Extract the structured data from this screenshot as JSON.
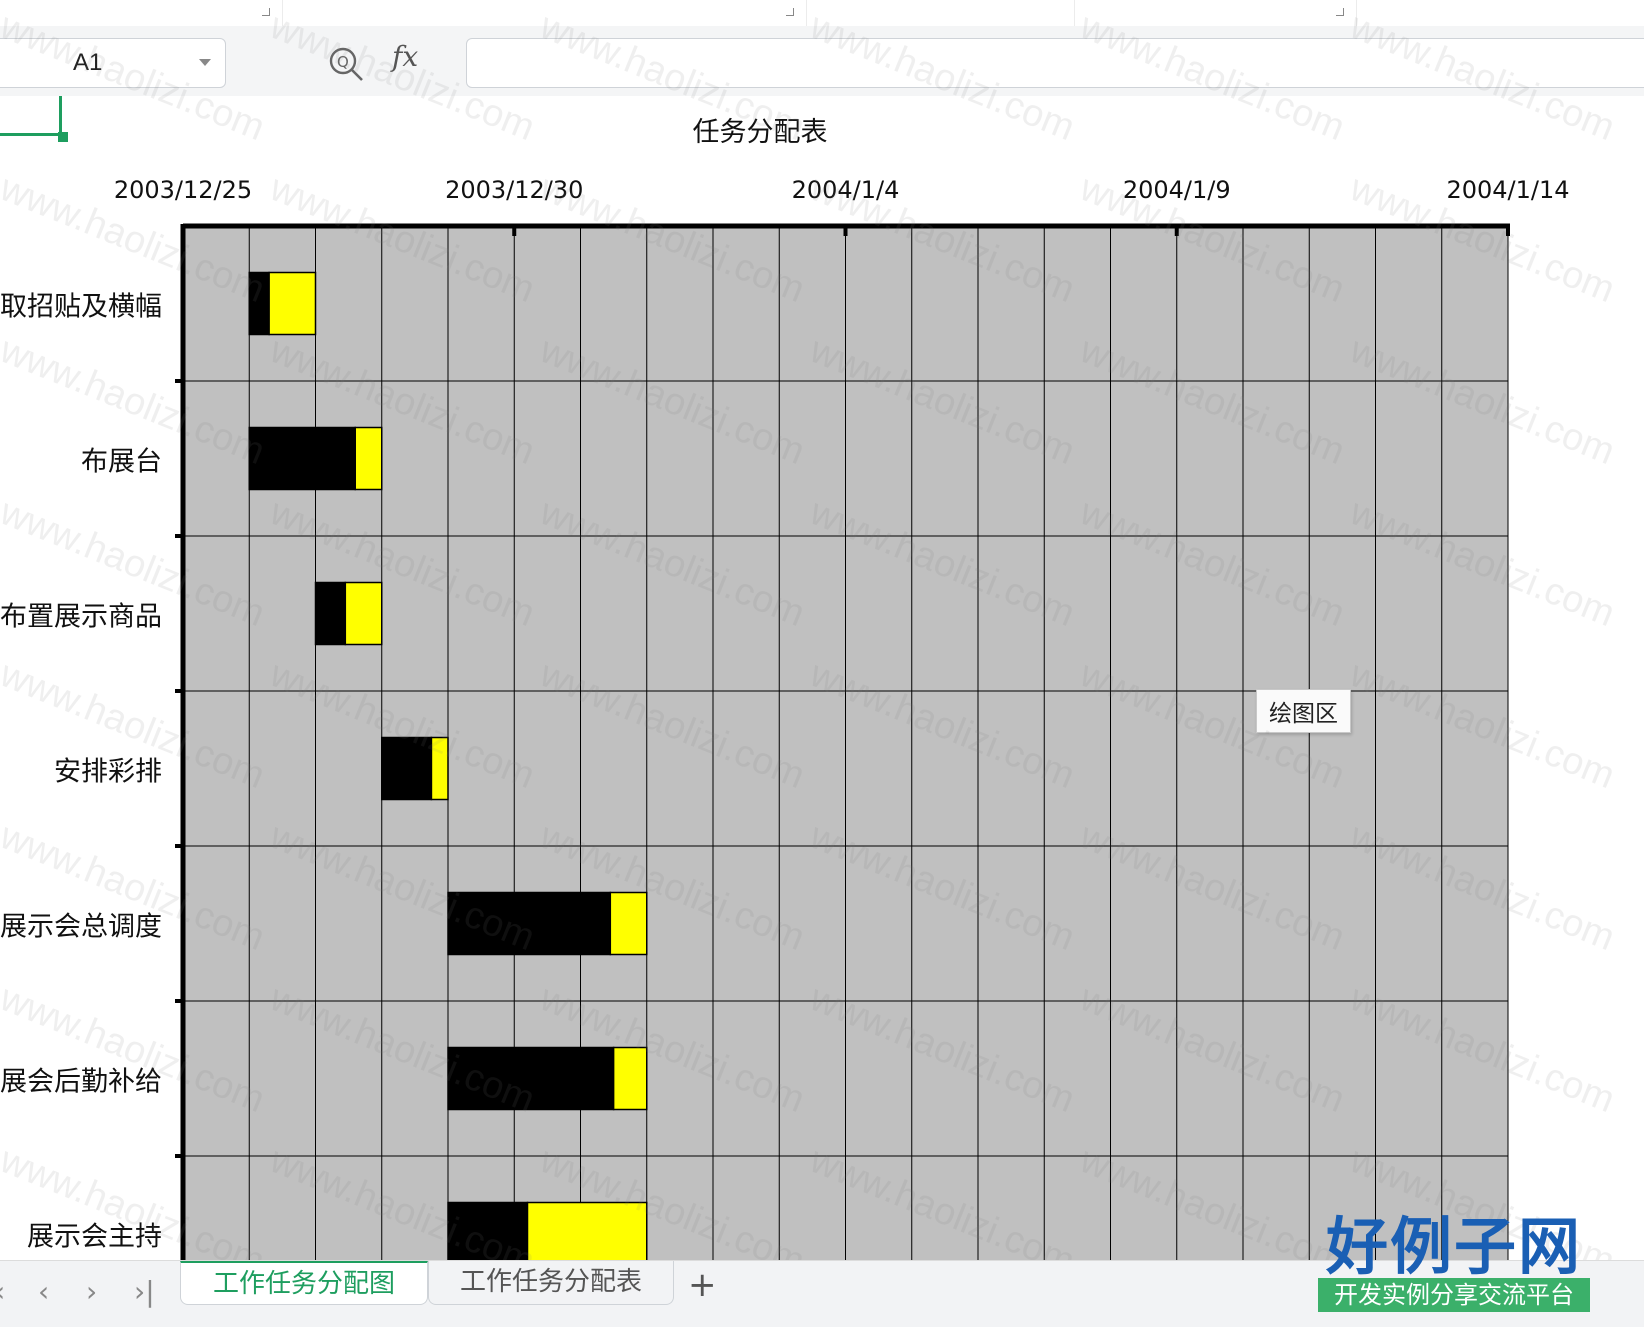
{
  "formula_bar": {
    "name_box": "A1",
    "fx_label": "fx",
    "formula_value": ""
  },
  "chart_data": {
    "type": "bar",
    "orientation": "horizontal-gantt",
    "title": "任务分配表",
    "xlabel": "",
    "ylabel": "",
    "x_axis_position": "top",
    "x_ticks": [
      "2003/12/25",
      "2003/12/30",
      "2004/1/4",
      "2004/1/9",
      "2004/1/14"
    ],
    "xlim": [
      "2003/12/25",
      "2004/1/14"
    ],
    "grid": true,
    "legend": "none",
    "categories": [
      "领取招贴及横幅",
      "布展台",
      "布置展示商品",
      "安排彩排",
      "展示会总调度",
      "展会后勤补给",
      "展示会主持"
    ],
    "series": [
      {
        "color": "#000000",
        "start": [
          "2003/12/26",
          "2003/12/26",
          "2003/12/27",
          "2003/12/28",
          "2003/12/29",
          "2003/12/29",
          "2003/12/29"
        ],
        "days": [
          0.3,
          1.6,
          0.45,
          0.75,
          2.45,
          2.5,
          1.2
        ]
      },
      {
        "color": "#ffff00",
        "days": [
          0.7,
          0.4,
          0.55,
          0.25,
          0.55,
          0.5,
          1.8
        ]
      }
    ],
    "plot_background": "#c0c0c0"
  },
  "tooltip": {
    "text": "绘图区"
  },
  "sheet_tabs": {
    "tabs": [
      {
        "label": "工作任务分配图",
        "active": true
      },
      {
        "label": "工作任务分配表",
        "active": false
      }
    ],
    "add_label": "+",
    "nav": [
      "‹",
      "‹",
      "›",
      "›|"
    ]
  },
  "watermark": {
    "text": "www.haolizi.com"
  },
  "logo": {
    "main": "好例子网",
    "sub": "开发实例分享交流平台"
  },
  "colors": {
    "accent": "#1e9e5f",
    "plot_bg": "#c0c0c0",
    "bar_done": "#000000",
    "bar_remaining": "#ffff00"
  }
}
